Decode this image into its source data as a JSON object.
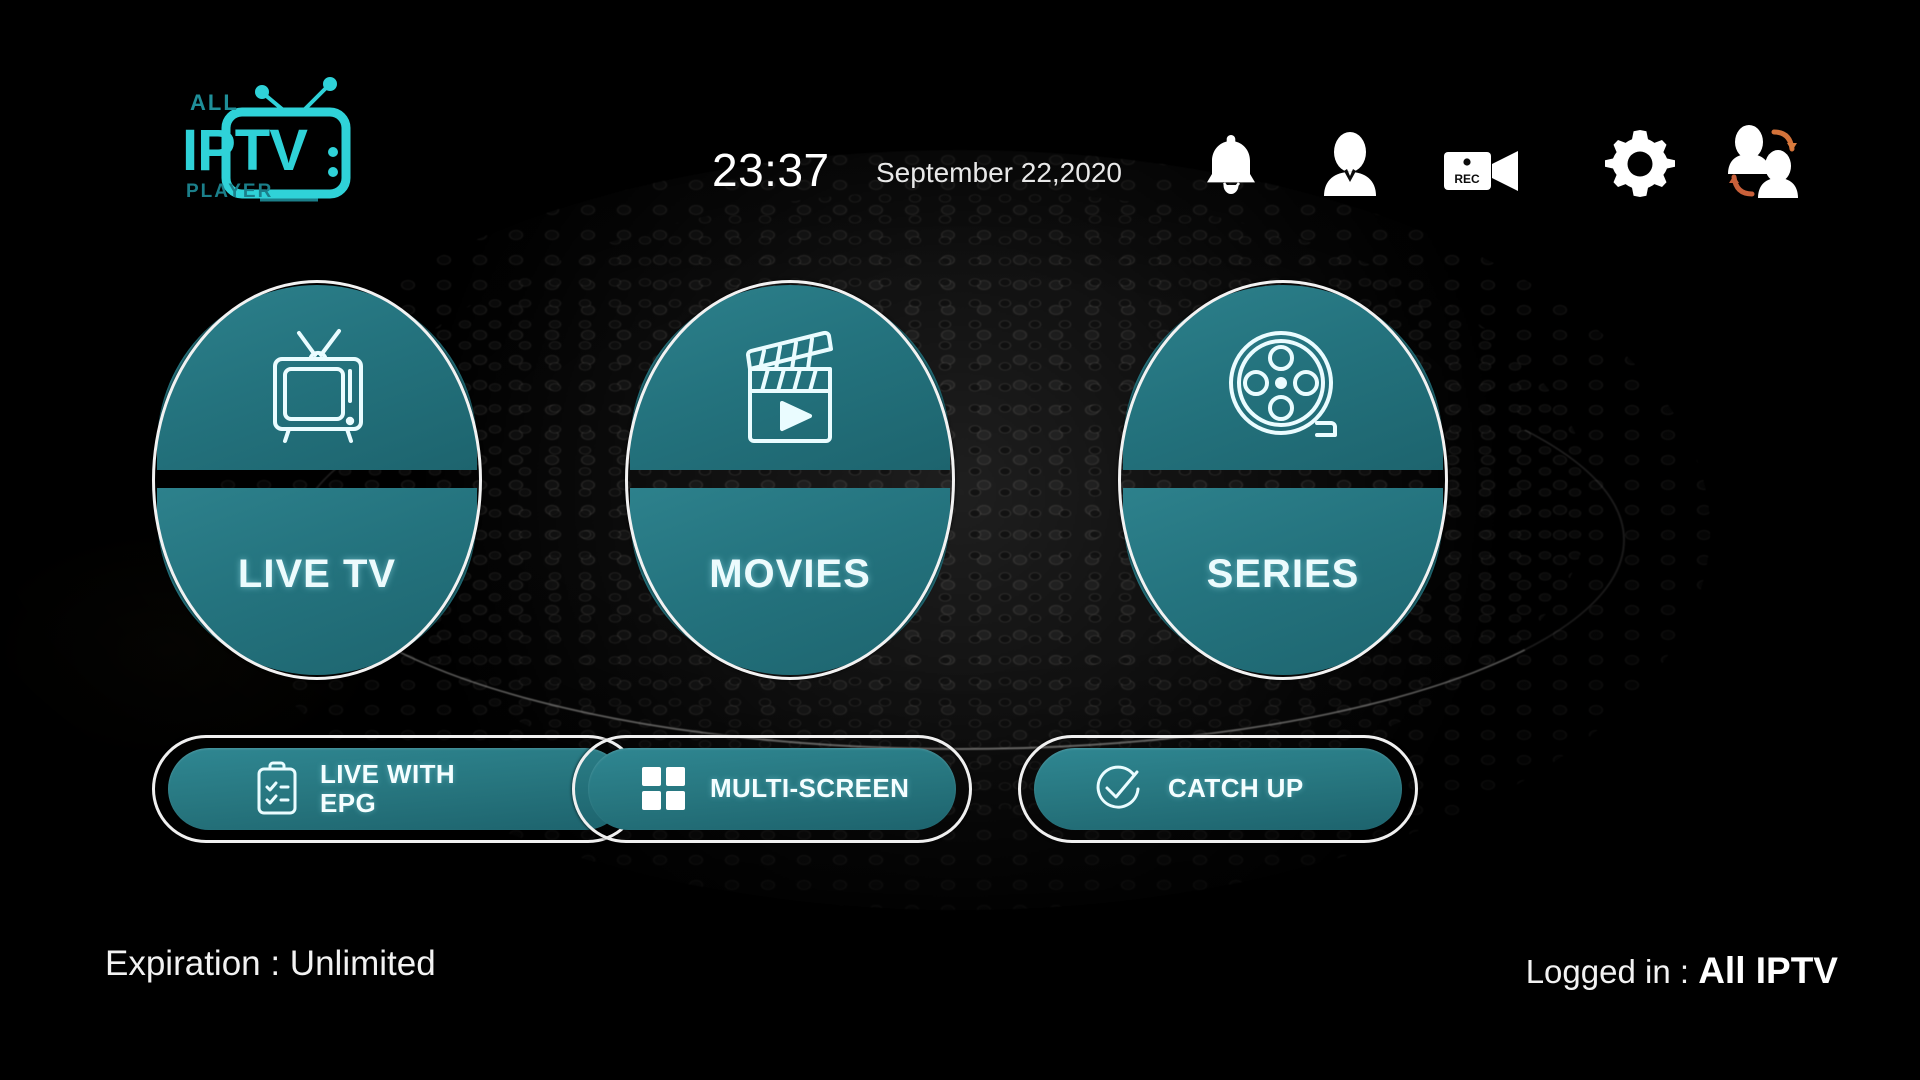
{
  "app": {
    "logo_line1": "ALL",
    "logo_main": "IPTV",
    "logo_line3": "PLAYER",
    "accent_teal": "#24737e",
    "accent_cyan": "#2fd2d8",
    "text_white": "#f2f2f2"
  },
  "header": {
    "time": "23:37",
    "date": "September 22,2020",
    "icons": [
      {
        "name": "notifications-icon",
        "label": "Notifications"
      },
      {
        "name": "user-account-icon",
        "label": "Account"
      },
      {
        "name": "recording-icon",
        "label": "REC"
      },
      {
        "name": "settings-gear-icon",
        "label": "Settings"
      },
      {
        "name": "switch-user-icon",
        "label": "Switch User"
      }
    ],
    "rec_label": "REC"
  },
  "tiles": [
    {
      "id": "live-tv",
      "label": "LIVE TV",
      "icon": "television-icon"
    },
    {
      "id": "movies",
      "label": "MOVIES",
      "icon": "clapperboard-play-icon"
    },
    {
      "id": "series",
      "label": "SERIES",
      "icon": "film-reel-icon"
    }
  ],
  "pills": [
    {
      "id": "live-with-epg",
      "label": "LIVE WITH\nEPG",
      "line1": "LIVE WITH",
      "line2": "EPG",
      "icon": "clipboard-checklist-icon"
    },
    {
      "id": "multi-screen",
      "label": "MULTI-SCREEN",
      "line1": "MULTI-SCREEN",
      "line2": "",
      "icon": "grid-four-icon"
    },
    {
      "id": "catch-up",
      "label": "CATCH UP",
      "line1": "CATCH UP",
      "line2": "",
      "icon": "circle-check-icon"
    }
  ],
  "footer": {
    "expiration": "Expiration : Unlimited",
    "logged_in_prefix": "Logged in : ",
    "logged_in_user": "All IPTV"
  }
}
